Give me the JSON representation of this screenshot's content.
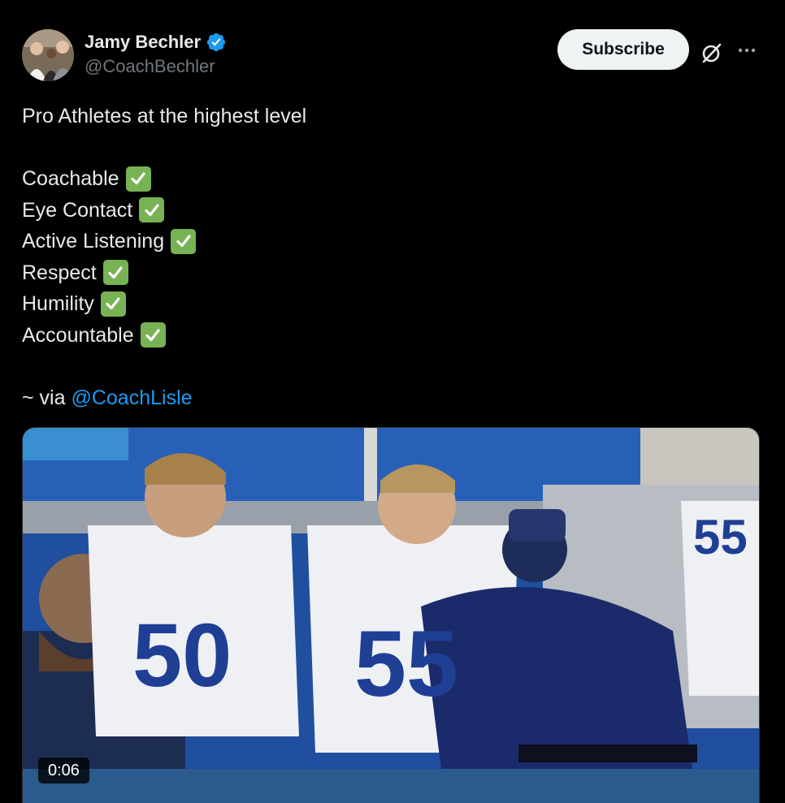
{
  "author": {
    "name": "Jamy Bechler",
    "handle": "@CoachBechler",
    "verified": true,
    "avatar": "avatar-photo"
  },
  "actions": {
    "subscribe_label": "Subscribe",
    "grok_icon": "grok-icon",
    "more_icon": "more-icon"
  },
  "tweet": {
    "intro": "Pro Athletes at the highest level",
    "items": [
      {
        "label": "Coachable",
        "icon": "check-box-icon"
      },
      {
        "label": "Eye Contact",
        "icon": "check-box-icon"
      },
      {
        "label": "Active Listening",
        "icon": "check-box-icon"
      },
      {
        "label": "Respect",
        "icon": "check-box-icon"
      },
      {
        "label": "Humility",
        "icon": "check-box-icon"
      },
      {
        "label": "Accountable",
        "icon": "check-box-icon"
      }
    ],
    "via_prefix": "~ via",
    "via_mention": "@CoachLisle"
  },
  "media": {
    "type": "video",
    "duration": "0:06",
    "jersey_numbers": [
      "50",
      "55",
      "55"
    ]
  },
  "colors": {
    "background": "#000000",
    "text": "#e7e9ea",
    "muted": "#71767b",
    "link": "#1d9bf0",
    "verified_badge": "#1d9bf0",
    "check_green": "#77b255"
  }
}
